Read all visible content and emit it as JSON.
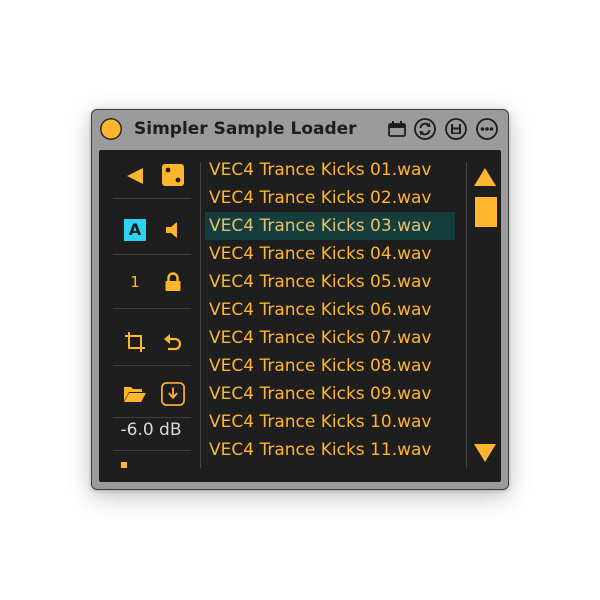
{
  "device": {
    "title": "Simpler Sample Loader",
    "colors": {
      "accent": "#ffb52e",
      "panel": "#1e1e1e",
      "frame": "#9b9b9b",
      "selected_row": "#153d3b",
      "active_toggle": "#2bd4f0"
    },
    "titlebar_icons": [
      "calendar-icon",
      "sync-icon",
      "save-icon",
      "more-icon"
    ]
  },
  "controls": {
    "key_number": "1",
    "auto_toggle_label": "A",
    "volume": "-6.0 dB"
  },
  "files": {
    "items": [
      "VEC4 Trance Kicks 01.wav",
      "VEC4 Trance Kicks 02.wav",
      "VEC4 Trance Kicks 03.wav",
      "VEC4 Trance Kicks 04.wav",
      "VEC4 Trance Kicks 05.wav",
      "VEC4 Trance Kicks 06.wav",
      "VEC4 Trance Kicks 07.wav",
      "VEC4 Trance Kicks 08.wav",
      "VEC4 Trance Kicks 09.wav",
      "VEC4 Trance Kicks 10.wav",
      "VEC4 Trance Kicks 11.wav"
    ],
    "selected_index": 2
  }
}
